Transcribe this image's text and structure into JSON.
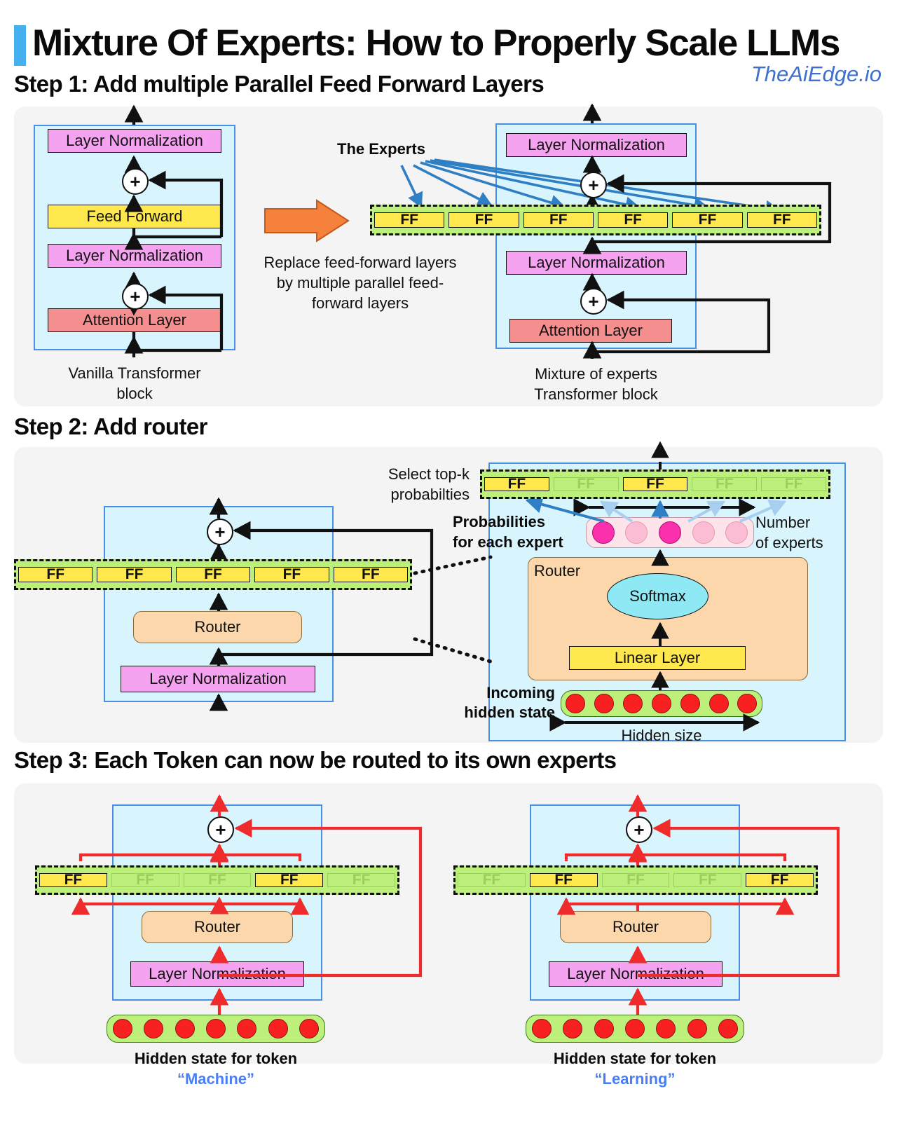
{
  "header": {
    "title": "Mixture Of Experts: How to Properly Scale LLMs",
    "brand": "TheAiEdge.io"
  },
  "steps": [
    {
      "heading": "Step 1: Add multiple Parallel Feed Forward Layers"
    },
    {
      "heading": "Step 2: Add router"
    },
    {
      "heading": "Step 3: Each Token can now be routed to its own experts"
    }
  ],
  "labels": {
    "layer_norm": "Layer Normalization",
    "feed_forward": "Feed Forward",
    "attention": "Attention Layer",
    "ff": "FF",
    "router": "Router",
    "softmax": "Softmax",
    "linear_layer": "Linear Layer",
    "plus": "+"
  },
  "step1": {
    "vanilla_caption_line1": "Vanilla Transformer",
    "vanilla_caption_line2": "block",
    "transition_text": "Replace feed-forward layers by multiple parallel feed-forward layers",
    "experts_label": "The Experts",
    "moe_caption_line1": "Mixture of experts",
    "moe_caption_line2": "Transformer block",
    "vanilla_stack": [
      "Layer Normalization",
      "Feed Forward",
      "Layer Normalization",
      "Attention Layer"
    ],
    "moe_stack_top": "Layer Normalization",
    "moe_stack_mid": "Layer Normalization",
    "moe_stack_bottom": "Attention Layer",
    "expert_count": 6,
    "experts": [
      "FF",
      "FF",
      "FF",
      "FF",
      "FF",
      "FF"
    ]
  },
  "step2": {
    "left_experts": [
      "FF",
      "FF",
      "FF",
      "FF",
      "FF"
    ],
    "left_router": "Router",
    "left_layer_norm": "Layer Normalization",
    "select_topk_line1": "Select top-k",
    "select_topk_line2": "probabilties",
    "probabilities_line1": "Probabilities",
    "probabilities_line2": "for each expert",
    "number_of_experts_line1": "Number",
    "number_of_experts_line2": "of experts",
    "incoming_line1": "Incoming",
    "incoming_line2": "hidden state",
    "hidden_size_label": "Hidden size",
    "router_title": "Router",
    "softmax_label": "Softmax",
    "linear_label": "Linear Layer",
    "right_experts": [
      {
        "label": "FF",
        "active": true
      },
      {
        "label": "FF",
        "active": false
      },
      {
        "label": "FF",
        "active": true
      },
      {
        "label": "FF",
        "active": false
      },
      {
        "label": "FF",
        "active": false
      }
    ],
    "probabilities": [
      {
        "selected": true
      },
      {
        "selected": false
      },
      {
        "selected": true
      },
      {
        "selected": false
      },
      {
        "selected": false
      }
    ],
    "hidden_state_cells": 7
  },
  "step3": {
    "left": {
      "experts": [
        {
          "label": "FF",
          "active": true
        },
        {
          "label": "FF",
          "active": false
        },
        {
          "label": "FF",
          "active": false
        },
        {
          "label": "FF",
          "active": true
        },
        {
          "label": "FF",
          "active": false
        }
      ],
      "router": "Router",
      "layer_norm": "Layer Normalization",
      "caption": "Hidden state for token",
      "token": "“Machine”",
      "hidden_state_cells": 7
    },
    "right": {
      "experts": [
        {
          "label": "FF",
          "active": false
        },
        {
          "label": "FF",
          "active": true
        },
        {
          "label": "FF",
          "active": false
        },
        {
          "label": "FF",
          "active": false
        },
        {
          "label": "FF",
          "active": true
        }
      ],
      "router": "Router",
      "layer_norm": "Layer Normalization",
      "caption": "Hidden state for token",
      "token": "“Learning”",
      "hidden_state_cells": 7
    }
  },
  "colors": {
    "accent_blue": "#45b0f0",
    "brand_blue": "#3d6fd0",
    "layer_norm": "#f5a3f0",
    "feed_forward": "#ffe84d",
    "attention": "#f58f8f",
    "router": "#fbd7ab",
    "softmax": "#8fe9f5",
    "expert_bank": "#bdf07a",
    "block_bg": "#d8f4fd",
    "panel_bg": "#f4f4f4",
    "arrow_orange": "#f5813c",
    "expert_arrow_blue": "#2f7fc4",
    "token_route_red": "#ef2b2b",
    "prob_high": "#fb30ad",
    "prob_low": "#fbbdd3",
    "hidden_cell": "#f82020"
  }
}
